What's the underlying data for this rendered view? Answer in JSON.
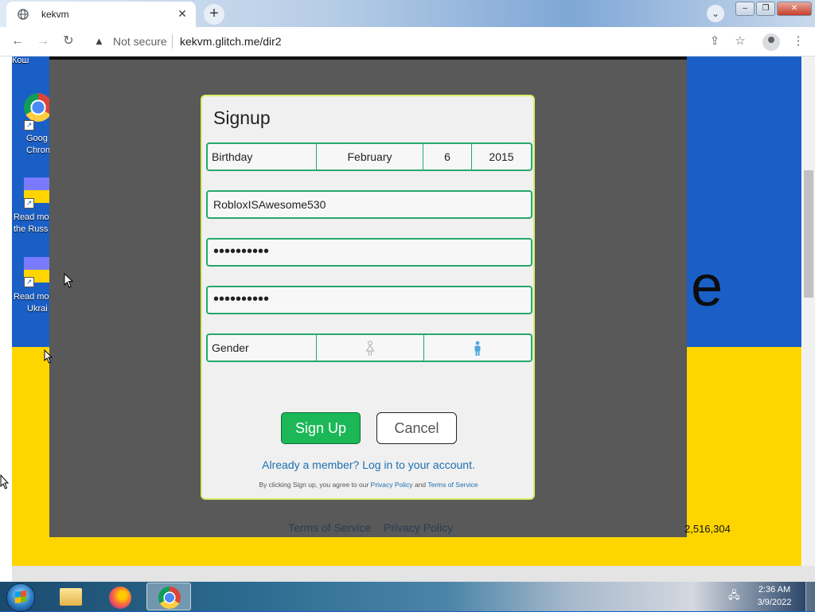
{
  "browser": {
    "tab_title": "kekvm",
    "not_secure_label": "Not secure",
    "url": "kekvm.glitch.me/dir2"
  },
  "desktop": {
    "icons": [
      {
        "label_line1": "Кош",
        "label_line2": ""
      },
      {
        "label_line1": "Goog",
        "label_line2": "Chron"
      },
      {
        "label_line1": "Read mo",
        "label_line2": "the Russ"
      },
      {
        "label_line1": "Read mo",
        "label_line2": "Ukrai"
      }
    ],
    "background_letter": "e"
  },
  "signup": {
    "title": "Signup",
    "birthday_label": "Birthday",
    "birthday_month": "February",
    "birthday_day": "6",
    "birthday_year": "2015",
    "username_value": "RobloxISAwesome530",
    "password_value": "••••••••••",
    "confirm_password_value": "••••••••••",
    "gender_label": "Gender",
    "signup_button": "Sign Up",
    "cancel_button": "Cancel",
    "already_member": "Already a member? Log in to your account.",
    "terms_prefix": "By clicking Sign up, you agree to our",
    "privacy_policy_link": "Privacy Policy",
    "terms_and": "and",
    "terms_of_service_link": "Terms of Service"
  },
  "page_footer": {
    "terms_link": "Terms of Service",
    "privacy_link": "Privacy Policy",
    "counter": "2,516,304"
  },
  "taskbar": {
    "time": "2:36 AM",
    "date": "3/9/2022"
  },
  "colors": {
    "accent_green": "#1cb858",
    "field_border": "#27a86a",
    "link_blue": "#1b6fb0",
    "flag_blue": "#1a5fc6",
    "flag_yellow": "#ffd500"
  }
}
